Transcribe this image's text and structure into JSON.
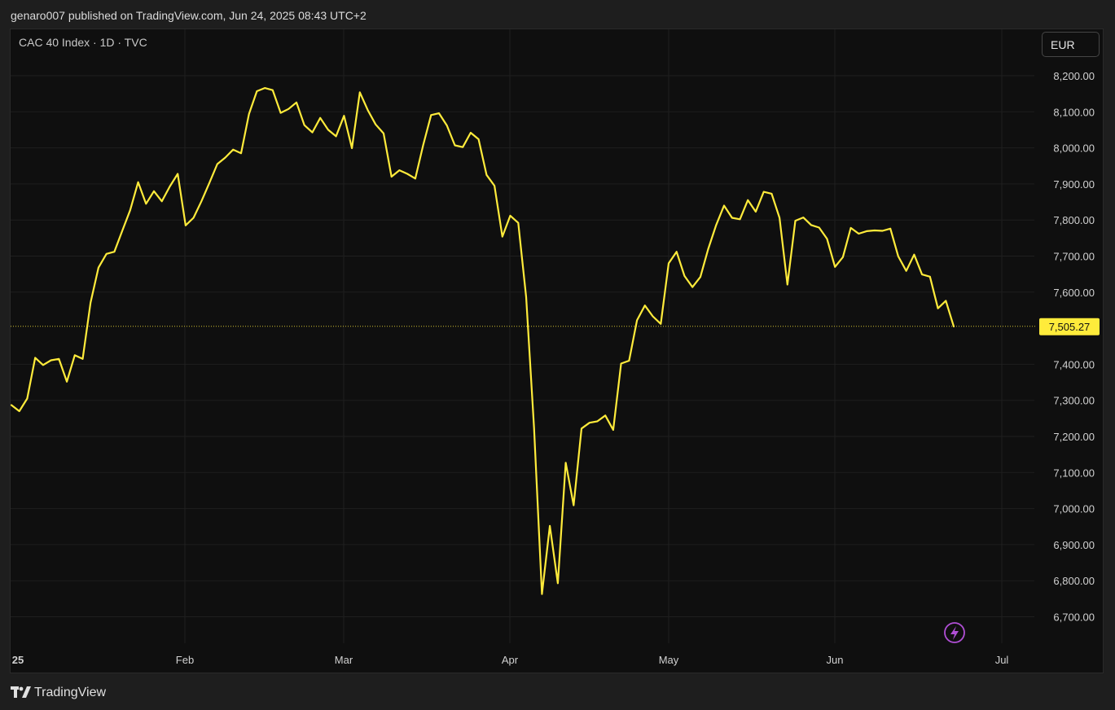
{
  "header": {
    "publish_line": "genaro007 published on TradingView.com, Jun 24, 2025 08:43 UTC+2"
  },
  "chart_header": {
    "symbol_line": "CAC 40 Index · 1D · TVC",
    "currency": "EUR"
  },
  "footer": {
    "brand": "TradingView"
  },
  "colors": {
    "line": "#ffeb3b",
    "grid": "#1f1f1f",
    "label_bg": "#ffeb3b",
    "accent_icon": "#b14fd6"
  },
  "chart_data": {
    "type": "line",
    "title": "CAC 40 Index · 1D · TVC",
    "x_tick_labels": [
      "25",
      "Feb",
      "Mar",
      "Apr",
      "May",
      "Jun",
      "Jul"
    ],
    "y_tick_labels": [
      "8,200.00",
      "8,100.00",
      "8,000.00",
      "7,900.00",
      "7,800.00",
      "7,700.00",
      "7,600.00",
      "7,400.00",
      "7,300.00",
      "7,200.00",
      "7,100.00",
      "7,000.00",
      "6,900.00",
      "6,800.00",
      "6,700.00"
    ],
    "ylim": [
      6640,
      8290
    ],
    "last_value_label": "7,505.27",
    "last_value": 7505.27,
    "grid": true,
    "series": [
      {
        "values": [
          7287,
          7270,
          7305,
          7418,
          7398,
          7411,
          7415,
          7352,
          7425,
          7415,
          7571,
          7668,
          7706,
          7712,
          7770,
          7827,
          7905,
          7845,
          7880,
          7852,
          7893,
          7928,
          7785,
          7806,
          7852,
          7903,
          7955,
          7973,
          7995,
          7985,
          8094,
          8157,
          8166,
          8160,
          8097,
          8108,
          8126,
          8063,
          8043,
          8083,
          8050,
          8032,
          8089,
          7999,
          8154,
          8105,
          8065,
          8040,
          7920,
          7938,
          7928,
          7915,
          8008,
          8091,
          8096,
          8062,
          8007,
          8002,
          8042,
          8024,
          7925,
          7895,
          7754,
          7812,
          7792,
          7587,
          7224,
          6763,
          6952,
          6793,
          7127,
          7009,
          7222,
          7238,
          7242,
          7258,
          7218,
          7402,
          7410,
          7522,
          7563,
          7533,
          7512,
          7680,
          7712,
          7645,
          7614,
          7642,
          7720,
          7786,
          7840,
          7806,
          7802,
          7855,
          7823,
          7878,
          7873,
          7806,
          7621,
          7798,
          7807,
          7786,
          7779,
          7748,
          7670,
          7697,
          7778,
          7762,
          7769,
          7771,
          7770,
          7776,
          7699,
          7659,
          7704,
          7649,
          7643,
          7555,
          7576,
          7505
        ]
      }
    ]
  }
}
